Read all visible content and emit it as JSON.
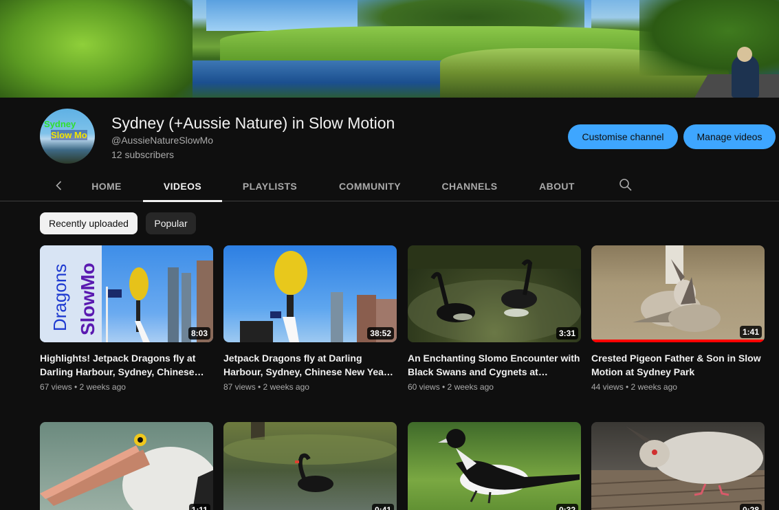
{
  "channel": {
    "title": "Sydney (+Aussie Nature) in Slow Motion",
    "handle": "@AussieNatureSlowMo",
    "subscribers": "12 subscribers",
    "avatar_text_line1": "Sydney",
    "avatar_text_line2": "Slow Mo",
    "customise_label": "Customise channel",
    "manage_label": "Manage videos"
  },
  "tabs": [
    "HOME",
    "VIDEOS",
    "PLAYLISTS",
    "COMMUNITY",
    "CHANNELS",
    "ABOUT"
  ],
  "active_tab": "VIDEOS",
  "chips": [
    "Recently uploaded",
    "Popular"
  ],
  "thumb_overlay_text": {
    "word1": "Dragons",
    "word2": "SlowMo"
  },
  "videos": [
    {
      "title": "Highlights! Jetpack Dragons fly at Darling Harbour, Sydney, Chinese…",
      "meta": "67 views • 2 weeks ago",
      "duration": "8:03",
      "art": "dragon1"
    },
    {
      "title": "Jetpack Dragons fly at Darling Harbour, Sydney, Chinese New Yea…",
      "meta": "87 views • 2 weeks ago",
      "duration": "38:52",
      "art": "dragon2"
    },
    {
      "title": "An Enchanting Slomo Encounter with Black Swans and Cygnets at…",
      "meta": "60 views • 2 weeks ago",
      "duration": "3:31",
      "art": "swans"
    },
    {
      "title": "Crested Pigeon Father & Son in Slow Motion at Sydney Park",
      "meta": "44 views • 2 weeks ago",
      "duration": "1:41",
      "art": "pigeon",
      "watched_fraction": 1.0
    },
    {
      "title": "",
      "meta": "",
      "duration": "1:11",
      "art": "pelican"
    },
    {
      "title": "",
      "meta": "",
      "duration": "0:41",
      "art": "swan2"
    },
    {
      "title": "",
      "meta": "",
      "duration": "0:32",
      "art": "magpie"
    },
    {
      "title": "",
      "meta": "",
      "duration": "0:28",
      "art": "pigeon2"
    }
  ],
  "colors": {
    "background": "#0f0f0f",
    "accent_button": "#3ea6ff",
    "progress": "#ff0000",
    "secondary_text": "#aaaaaa"
  },
  "icons": {
    "tab_prev": "chevron-left-icon",
    "tab_search": "search-icon"
  }
}
